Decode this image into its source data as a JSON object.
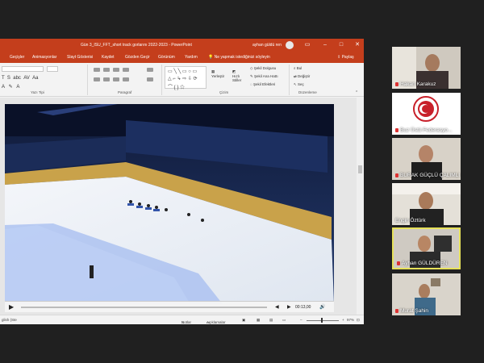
{
  "window": {
    "doc_title": "Gün 3_ISU_FFT_short track gorlarını 2022-2023  -  PowerPoint",
    "user_name": "ayhan güldü ren"
  },
  "ribbon_tabs": [
    "Geçişler",
    "Animasyonlar",
    "Slayt Gösterisi",
    "Kaydet",
    "Gözden Geçir",
    "Görünüm",
    "Yardım"
  ],
  "tell_me": "Ne yapmak istediğinizi söyleyin",
  "share": "Paylaş",
  "ribbon": {
    "groups": [
      "Yazı Tipi",
      "Paragraf",
      "Çizim",
      "Düzenleme"
    ],
    "buttons": {
      "arrange": "Yerleştir",
      "quick_styles": "Hızlı Stiller",
      "shape_fill": "Şekil Dolgusu",
      "shape_outline": "Şekil Ana Hattı",
      "shape_effects": "Şekil Efektleri",
      "find": "Bul",
      "replace": "Değiştir",
      "select": "Seç"
    }
  },
  "player": {
    "time": "00:13,00",
    "progress": 0.0
  },
  "statusbar": {
    "language": "glish (Ste",
    "notes": "Notlar",
    "comments": "Açıklamalar",
    "zoom": "97%"
  },
  "participants": [
    {
      "name": "Hakan Karakuz",
      "has_mic_off": true,
      "active": false
    },
    {
      "name": "Buz Üstü Federasyo...",
      "has_mic_off": true,
      "active": false
    },
    {
      "name": "BURAK GÜÇLÜ ÇALIMLI",
      "has_mic_off": true,
      "active": false
    },
    {
      "name": "Engin Öztürk",
      "has_mic_off": false,
      "active": false
    },
    {
      "name": "Ayhan GÜLDÜREN",
      "has_mic_off": true,
      "active": true
    },
    {
      "name": "Murat Şahin",
      "has_mic_off": true,
      "active": false
    }
  ],
  "colors": {
    "accent": "#c43e1c",
    "active_tile": "#e6e15a"
  }
}
